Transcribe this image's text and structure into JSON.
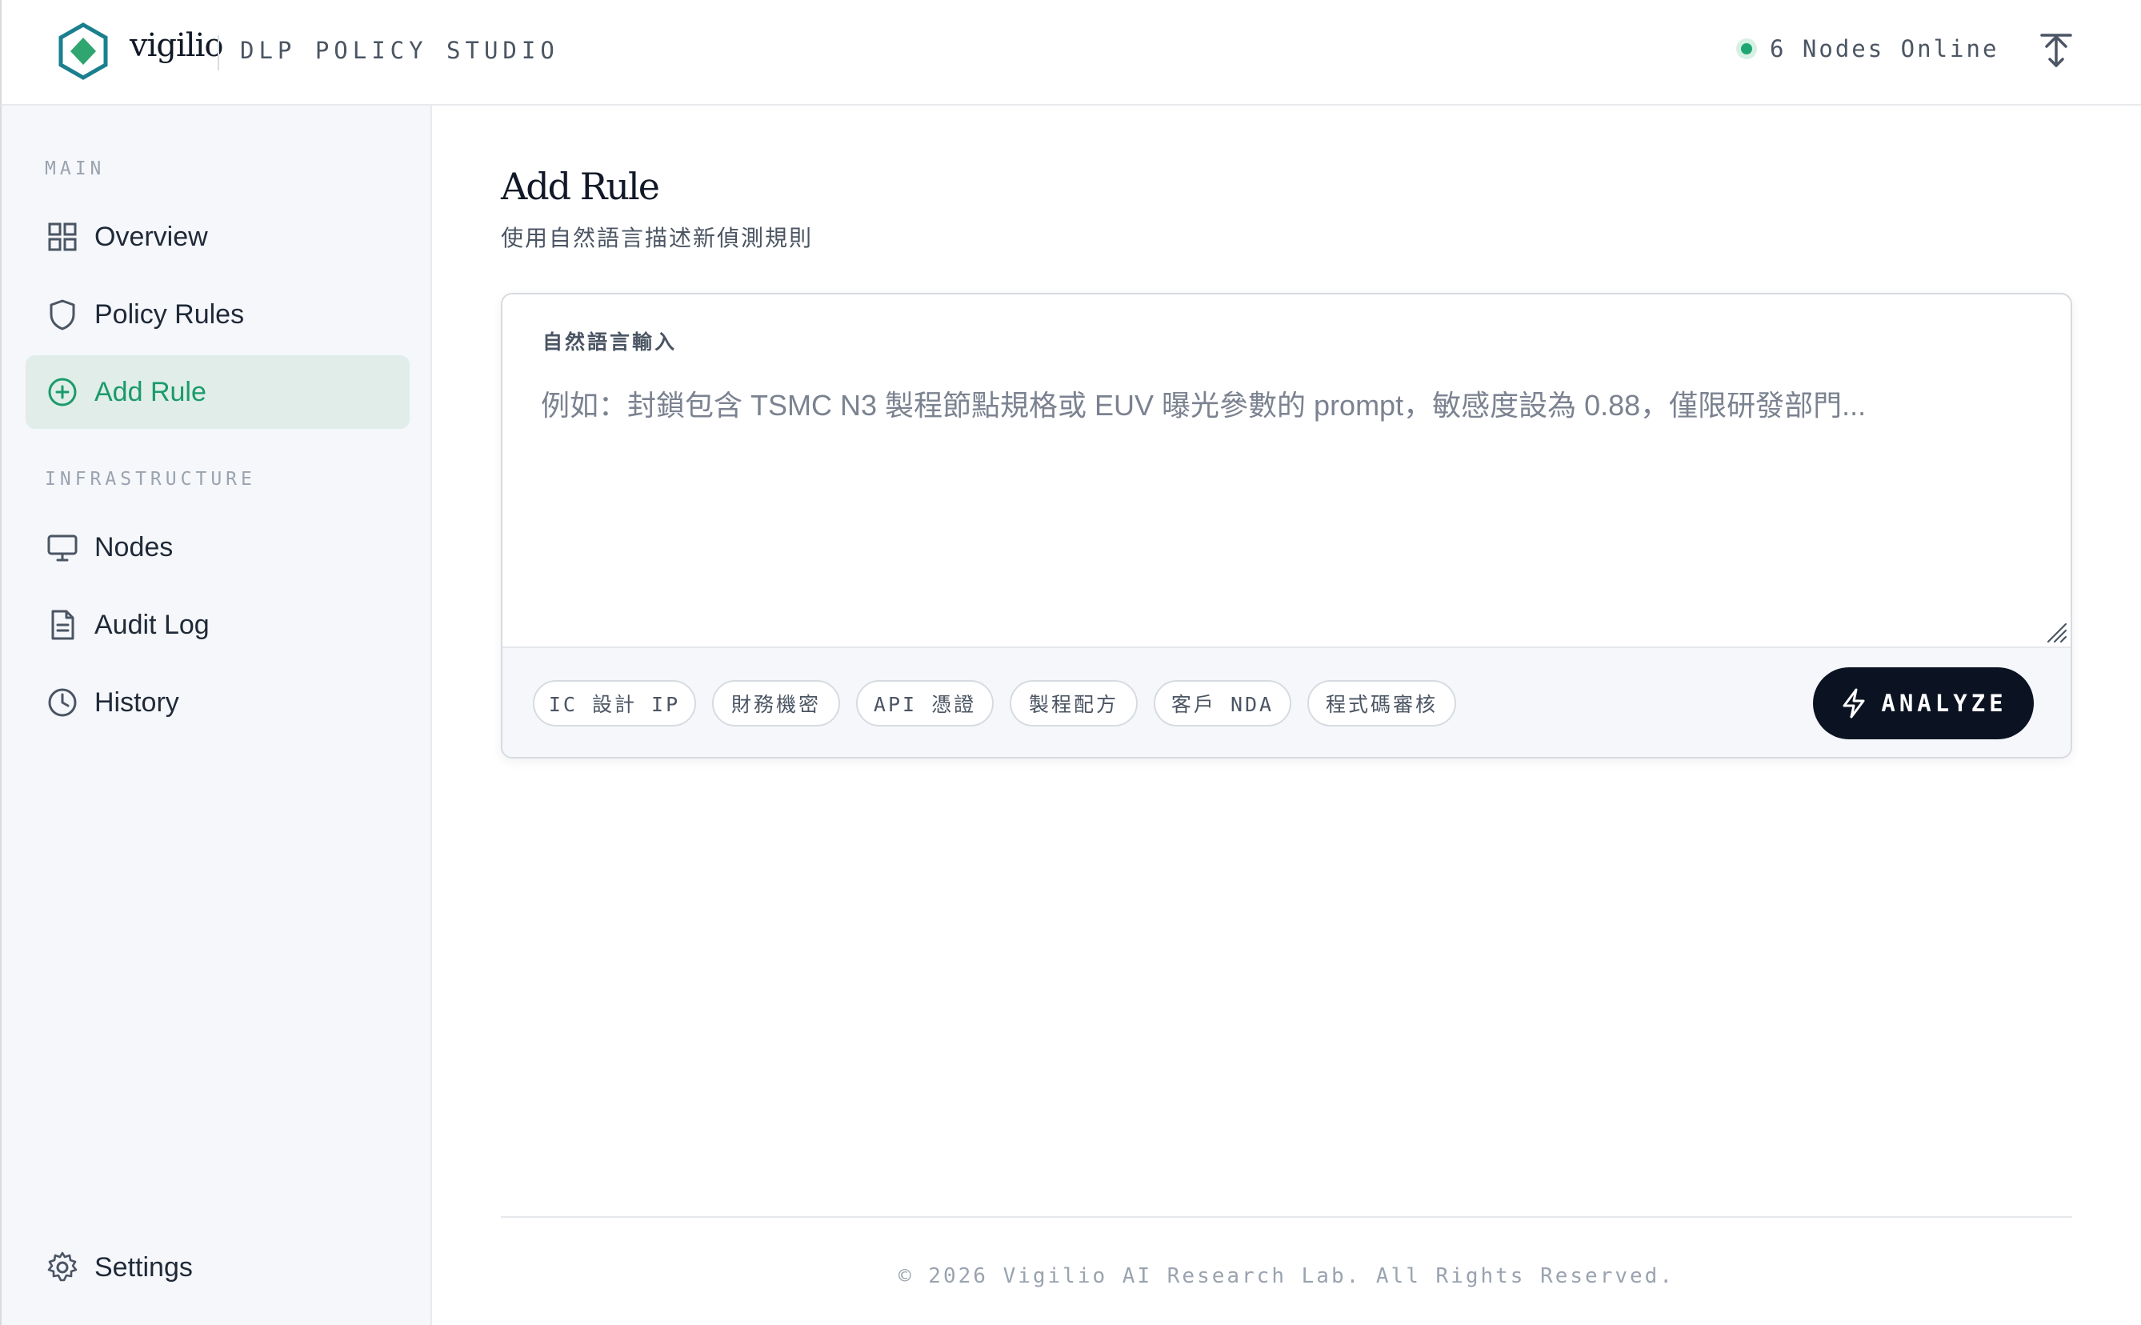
{
  "header": {
    "brand": "vigilio",
    "product": "DLP POLICY STUDIO",
    "status_text": "6 Nodes Online",
    "status_color": "#1ea672",
    "brand_color": "#1a7f8e",
    "accent_color": "#2fa56f"
  },
  "sidebar": {
    "sections": [
      {
        "label": "MAIN",
        "items": [
          {
            "label": "Overview",
            "icon": "grid-icon"
          },
          {
            "label": "Policy Rules",
            "icon": "shield-icon"
          },
          {
            "label": "Add Rule",
            "icon": "plus-circle-icon",
            "active": true
          }
        ]
      },
      {
        "label": "INFRASTRUCTURE",
        "items": [
          {
            "label": "Nodes",
            "icon": "monitor-icon"
          },
          {
            "label": "Audit Log",
            "icon": "document-icon"
          },
          {
            "label": "History",
            "icon": "clock-icon"
          }
        ]
      }
    ],
    "settings_label": "Settings"
  },
  "main": {
    "title": "Add Rule",
    "subtitle": "使用自然語言描述新偵測規則",
    "input_label": "自然語言輸入",
    "input_placeholder": "例如：封鎖包含 TSMC N3 製程節點規格或 EUV 曝光參數的 prompt，敏感度設為 0.88，僅限研發部門...",
    "input_value": "",
    "chips": [
      "IC 設計 IP",
      "財務機密",
      "API 憑證",
      "製程配方",
      "客戶 NDA",
      "程式碼審核"
    ],
    "analyze_label": "ANALYZE",
    "analyze_bg": "#0b1322"
  },
  "footer": {
    "copyright": "© 2026 Vigilio AI Research Lab. All Rights Reserved."
  }
}
